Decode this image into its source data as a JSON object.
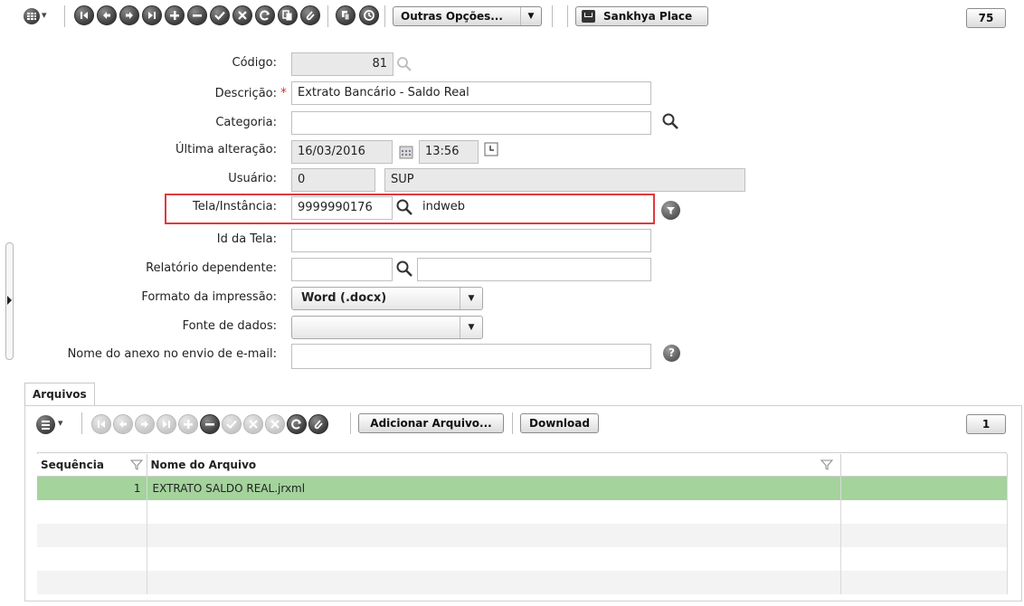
{
  "toolbar": {
    "outras_opcoes_label": "Outras Opções...",
    "outras_opcoes_arrow": "▼",
    "sankhya_place_label": "Sankhya Place",
    "page_number": "75",
    "grid_menu_arrow": "▾"
  },
  "form": {
    "codigo": {
      "label": "Código:",
      "value": "81"
    },
    "descricao": {
      "label": "Descrição:",
      "required_mark": "*",
      "value": "Extrato Bancário - Saldo Real"
    },
    "categoria": {
      "label": "Categoria:",
      "value": ""
    },
    "ultima_alteracao": {
      "label": "Última alteração:",
      "date": "16/03/2016",
      "time": "13:56"
    },
    "usuario": {
      "label": "Usuário:",
      "id": "0",
      "name": "SUP"
    },
    "tela_instancia": {
      "label": "Tela/Instância:",
      "code": "9999990176",
      "name": "indweb"
    },
    "id_da_tela": {
      "label": "Id da Tela:",
      "value": ""
    },
    "relatorio_dependente": {
      "label": "Relatório dependente:",
      "code": "",
      "name": ""
    },
    "formato_impressao": {
      "label": "Formato da impressão:",
      "value": "Word (.docx)"
    },
    "fonte_dados": {
      "label": "Fonte de dados:",
      "value": ""
    },
    "nome_anexo": {
      "label": "Nome do anexo no envio de e-mail:",
      "value": ""
    }
  },
  "files_tab": {
    "tab_label": "Arquivos",
    "adicionar_label": "Adicionar Arquivo...",
    "download_label": "Download",
    "page_number": "1",
    "columns": [
      "Sequência",
      "Nome do Arquivo"
    ],
    "rows": [
      {
        "seq": "1",
        "name": "EXTRATO SALDO REAL.jrxml"
      }
    ]
  },
  "colors": {
    "highlight_border": "#e0393e",
    "selected_row": "#a4d39c"
  }
}
